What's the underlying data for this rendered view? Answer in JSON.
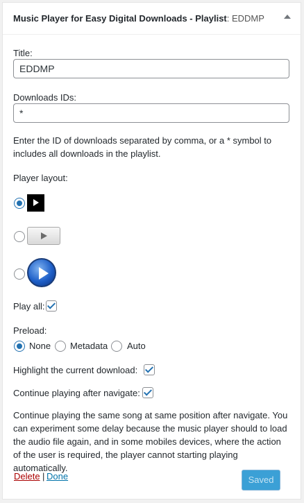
{
  "widget": {
    "title": "Music Player for Easy Digital Downloads - Playlist",
    "title_suffix": ": EDDMP"
  },
  "form": {
    "title_label": "Title:",
    "title_value": "EDDMP",
    "ids_label": "Downloads IDs:",
    "ids_value": "*",
    "ids_help": "Enter the ID of downloads separated by comma, or a * symbol to includes all downloads in the playlist.",
    "layout_label": "Player layout:",
    "layout_options": [
      {
        "icon": "black-square-play-icon",
        "selected": true
      },
      {
        "icon": "grey-button-play-icon",
        "selected": false
      },
      {
        "icon": "blue-circle-play-icon",
        "selected": false
      }
    ],
    "play_all_label": "Play all:",
    "play_all_checked": true,
    "preload_label": "Preload:",
    "preload_options": [
      {
        "label": "None",
        "selected": true
      },
      {
        "label": "Metadata",
        "selected": false
      },
      {
        "label": "Auto",
        "selected": false
      }
    ],
    "highlight_label": "Highlight the current download:",
    "highlight_checked": true,
    "continue_label": "Continue playing after navigate:",
    "continue_checked": true,
    "continue_help": "Continue playing the same song at same position after navigate. You can experiment some delay because the music player should to load the audio file again, and in some mobiles devices, where the action of the user is required, the player cannot starting playing automatically."
  },
  "actions": {
    "delete_label": "Delete",
    "separator": "|",
    "done_label": "Done",
    "saved_label": "Saved"
  },
  "colors": {
    "delete_link": "#a00",
    "done_link": "#0073aa",
    "accent": "#2271b1"
  }
}
